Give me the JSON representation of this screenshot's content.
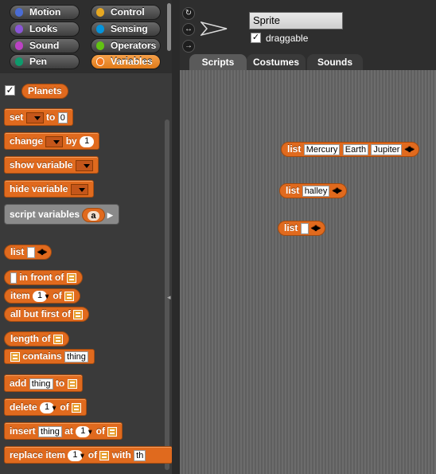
{
  "categories": {
    "left": [
      {
        "label": "Motion",
        "color": "#4a6cd4"
      },
      {
        "label": "Looks",
        "color": "#8a55d7"
      },
      {
        "label": "Sound",
        "color": "#bb42c3"
      },
      {
        "label": "Pen",
        "color": "#0e9a6c"
      }
    ],
    "right": [
      {
        "label": "Control",
        "color": "#e6a822"
      },
      {
        "label": "Sensing",
        "color": "#0494dc"
      },
      {
        "label": "Operators",
        "color": "#62c213"
      },
      {
        "label": "Variables",
        "color": "#f3761d",
        "active": true
      }
    ]
  },
  "palette": {
    "variable_checkbox": "✓",
    "variable_name": "Planets",
    "set_label": "set",
    "set_to": "to",
    "set_value": "0",
    "change_label": "change",
    "change_by": "by",
    "change_value": "1",
    "show_variable": "show variable",
    "hide_variable": "hide variable",
    "script_variables": "script variables",
    "script_var_name": "a",
    "list_label": "list",
    "in_front_of": "in front of",
    "item_label": "item",
    "item_index": "1",
    "of_label": "of",
    "all_but_first": "all but first of",
    "length_of": "length of",
    "contains": "contains",
    "thing": "thing",
    "add_label": "add",
    "to_label": "to",
    "delete_label": "delete",
    "insert_label": "insert",
    "at_label": "at",
    "replace_label": "replace item",
    "with_label": "with",
    "with_value": "th"
  },
  "sprite": {
    "name": "Sprite",
    "draggable_label": "draggable",
    "draggable_checked": "✓",
    "rotate_icon_1": "↻",
    "rotate_icon_2": "↔",
    "rotate_icon_3": "→"
  },
  "tabs": [
    {
      "label": "Scripts",
      "active": true
    },
    {
      "label": "Costumes"
    },
    {
      "label": "Sounds"
    }
  ],
  "scripts": {
    "list_label": "list",
    "list1": [
      "Mercury",
      "Earth",
      "Jupiter"
    ],
    "list2": [
      "halley"
    ],
    "list3": [
      ""
    ]
  }
}
